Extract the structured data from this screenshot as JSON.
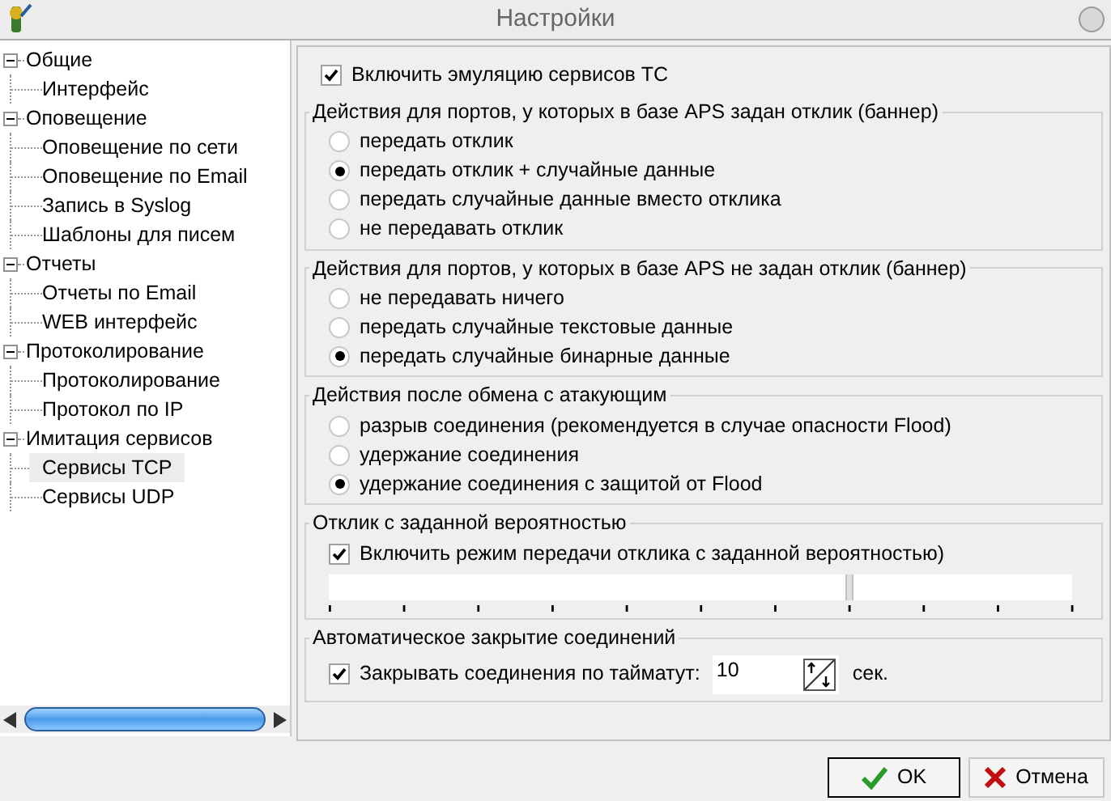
{
  "window": {
    "title": "Настройки"
  },
  "tree": [
    {
      "label": "Общие",
      "expanded": true,
      "selected": false,
      "children": [
        {
          "label": "Интерфейс",
          "selected": false
        }
      ]
    },
    {
      "label": "Оповещение",
      "expanded": true,
      "selected": false,
      "children": [
        {
          "label": "Оповещение по сети",
          "selected": false
        },
        {
          "label": "Оповещение по Email",
          "selected": false
        },
        {
          "label": "Запись в Syslog",
          "selected": false
        },
        {
          "label": "Шаблоны для писем",
          "selected": false
        }
      ]
    },
    {
      "label": "Отчеты",
      "expanded": true,
      "selected": false,
      "children": [
        {
          "label": "Отчеты по Email",
          "selected": false
        },
        {
          "label": "WEB интерфейс",
          "selected": false
        }
      ]
    },
    {
      "label": "Протоколирование",
      "expanded": true,
      "selected": false,
      "children": [
        {
          "label": "Протоколирование",
          "selected": false
        },
        {
          "label": "Протокол по IP",
          "selected": false
        }
      ]
    },
    {
      "label": "Имитация сервисов",
      "expanded": true,
      "selected": false,
      "children": [
        {
          "label": "Сервисы TCP",
          "selected": true
        },
        {
          "label": "Сервисы UDP",
          "selected": false
        }
      ]
    }
  ],
  "emulation": {
    "label": "Включить эмуляцию сервисов TC",
    "checked": true
  },
  "groups": [
    {
      "kind": "radio",
      "title": "Действия для портов, у которых в базе APS задан отклик (баннер)",
      "options": [
        {
          "label": "передать отклик",
          "selected": false
        },
        {
          "label": "передать отклик + случайные данные",
          "selected": true
        },
        {
          "label": "передать случайные данные вместо отклика",
          "selected": false
        },
        {
          "label": "не передавать отклик",
          "selected": false
        }
      ]
    },
    {
      "kind": "radio",
      "title": "Действия для портов, у которых в базе APS не задан отклик (баннер)",
      "options": [
        {
          "label": "не передавать ничего",
          "selected": false
        },
        {
          "label": "передать случайные текстовые данные",
          "selected": false
        },
        {
          "label": "передать случайные бинарные данные",
          "selected": true
        }
      ]
    },
    {
      "kind": "radio",
      "title": "Действия после обмена с атакующим",
      "options": [
        {
          "label": "разрыв соединения (рекомендуется в случае опасности Flood)",
          "selected": false
        },
        {
          "label": "удержание соединения",
          "selected": false
        },
        {
          "label": "удержание соединения с защитой от Flood",
          "selected": true
        }
      ]
    },
    {
      "kind": "slider",
      "title": "Отклик с заданной вероятностью",
      "checkbox": {
        "label": "Включить режим передачи отклика с заданной вероятностью)",
        "checked": true
      },
      "level": 0.7
    },
    {
      "kind": "timeout",
      "title": "Автоматическое закрытие соединений",
      "checkbox": {
        "label": "Закрывать соединения по тайматут:",
        "checked": true
      },
      "value": "10",
      "unit": "сек."
    }
  ],
  "buttons": [
    {
      "kind": "ok",
      "label": "OK"
    },
    {
      "kind": "cancel",
      "label": "Отмена"
    }
  ]
}
